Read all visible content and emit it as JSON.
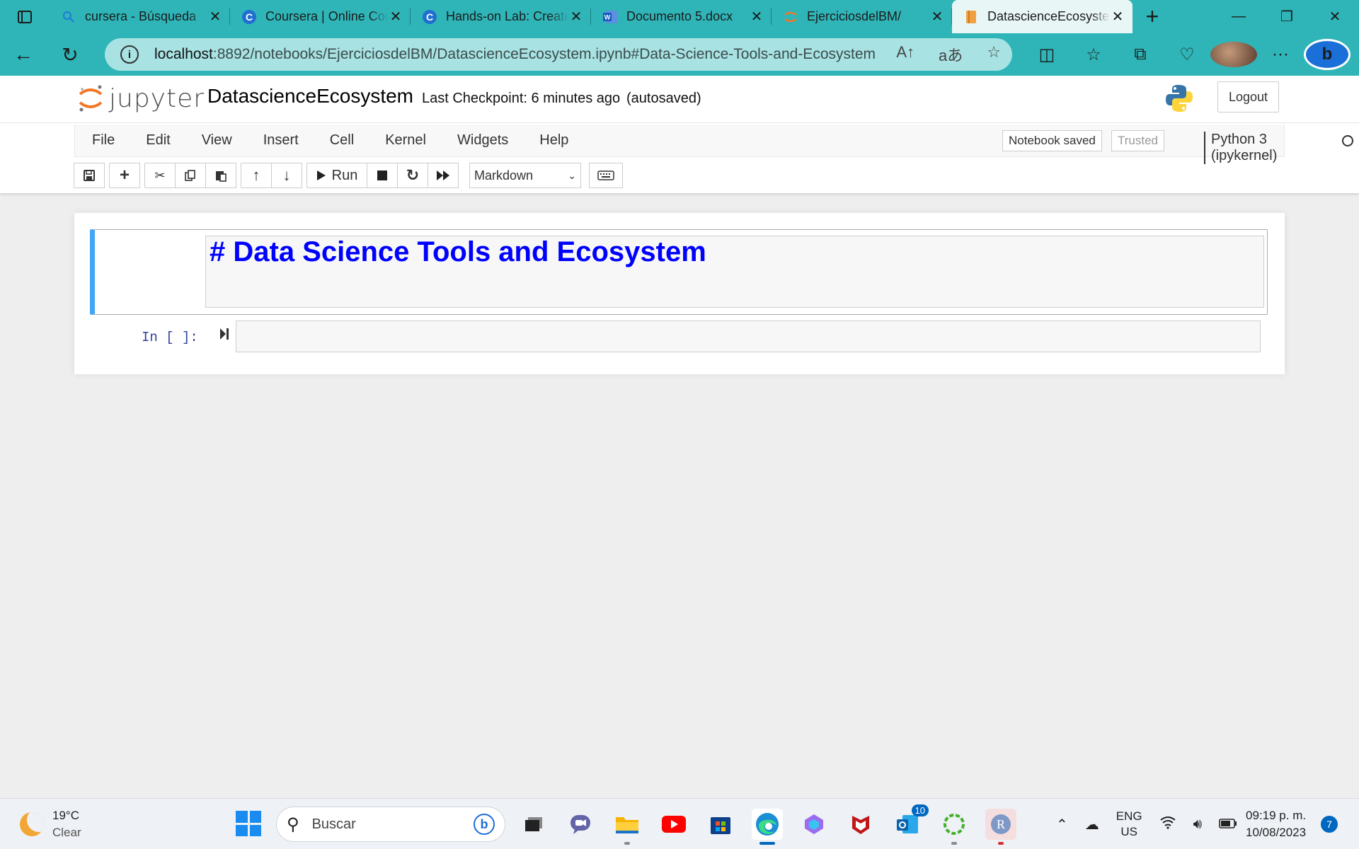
{
  "browser": {
    "tabs": [
      {
        "title": "cursera - Búsqueda",
        "icon": "search-icon"
      },
      {
        "title": "Coursera | Online Courses",
        "icon": "coursera-icon"
      },
      {
        "title": "Hands-on Lab: Create",
        "icon": "coursera-icon"
      },
      {
        "title": "Documento 5.docx",
        "icon": "word-icon"
      },
      {
        "title": "EjerciciosdelBM/",
        "icon": "jupyter-icon"
      },
      {
        "title": "DatascienceEcosystem",
        "icon": "notebook-icon"
      }
    ],
    "url_host": "localhost",
    "url_path": ":8892/notebooks/EjerciciosdelBM/DatascienceEcosystem.ipynb#Data-Science-Tools-and-Ecosystem"
  },
  "jupyter": {
    "logo_text": "jupyter",
    "notebook_name": "DatascienceEcosystem",
    "checkpoint": "Last Checkpoint: 6 minutes ago",
    "autosaved": "(autosaved)",
    "logout_label": "Logout",
    "menu": [
      "File",
      "Edit",
      "View",
      "Insert",
      "Cell",
      "Kernel",
      "Widgets",
      "Help"
    ],
    "notebook_status": "Notebook saved",
    "trusted": "Trusted",
    "kernel": "Python 3 (ipykernel)",
    "toolbar": {
      "run_label": "Run",
      "cell_type": "Markdown"
    },
    "cells": {
      "markdown_source": "# Data Science Tools and Ecosystem",
      "code_prompt": "In [ ]:"
    }
  },
  "taskbar": {
    "temperature": "19°C",
    "weather_desc": "Clear",
    "search_placeholder": "Buscar",
    "lang_line1": "ENG",
    "lang_line2": "US",
    "time": "09:19 p. m.",
    "date": "10/08/2023",
    "notification_count": "7",
    "store_badge": "10"
  },
  "colors": {
    "browser_accent": "#2fb5b8",
    "markdown_heading": "#0000ff",
    "cell_selected_border": "#42a5f5",
    "prompt_color": "#303f9f"
  }
}
